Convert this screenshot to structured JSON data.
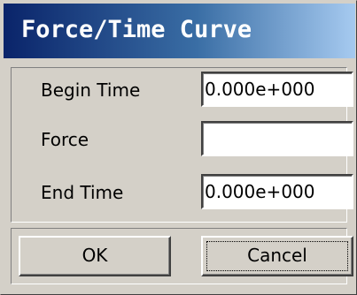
{
  "window": {
    "title": "Force/Time Curve"
  },
  "form": {
    "begin_time": {
      "label": "Begin Time",
      "value": "0.000e+000"
    },
    "force": {
      "label": "Force",
      "value": ""
    },
    "end_time": {
      "label": "End Time",
      "value": "0.000e+000"
    }
  },
  "buttons": {
    "ok_label": "OK",
    "cancel_label": "Cancel"
  },
  "colors": {
    "titlebar_start": "#0a246a",
    "titlebar_end": "#a6caf0",
    "dialog_face": "#d4d0c8"
  }
}
